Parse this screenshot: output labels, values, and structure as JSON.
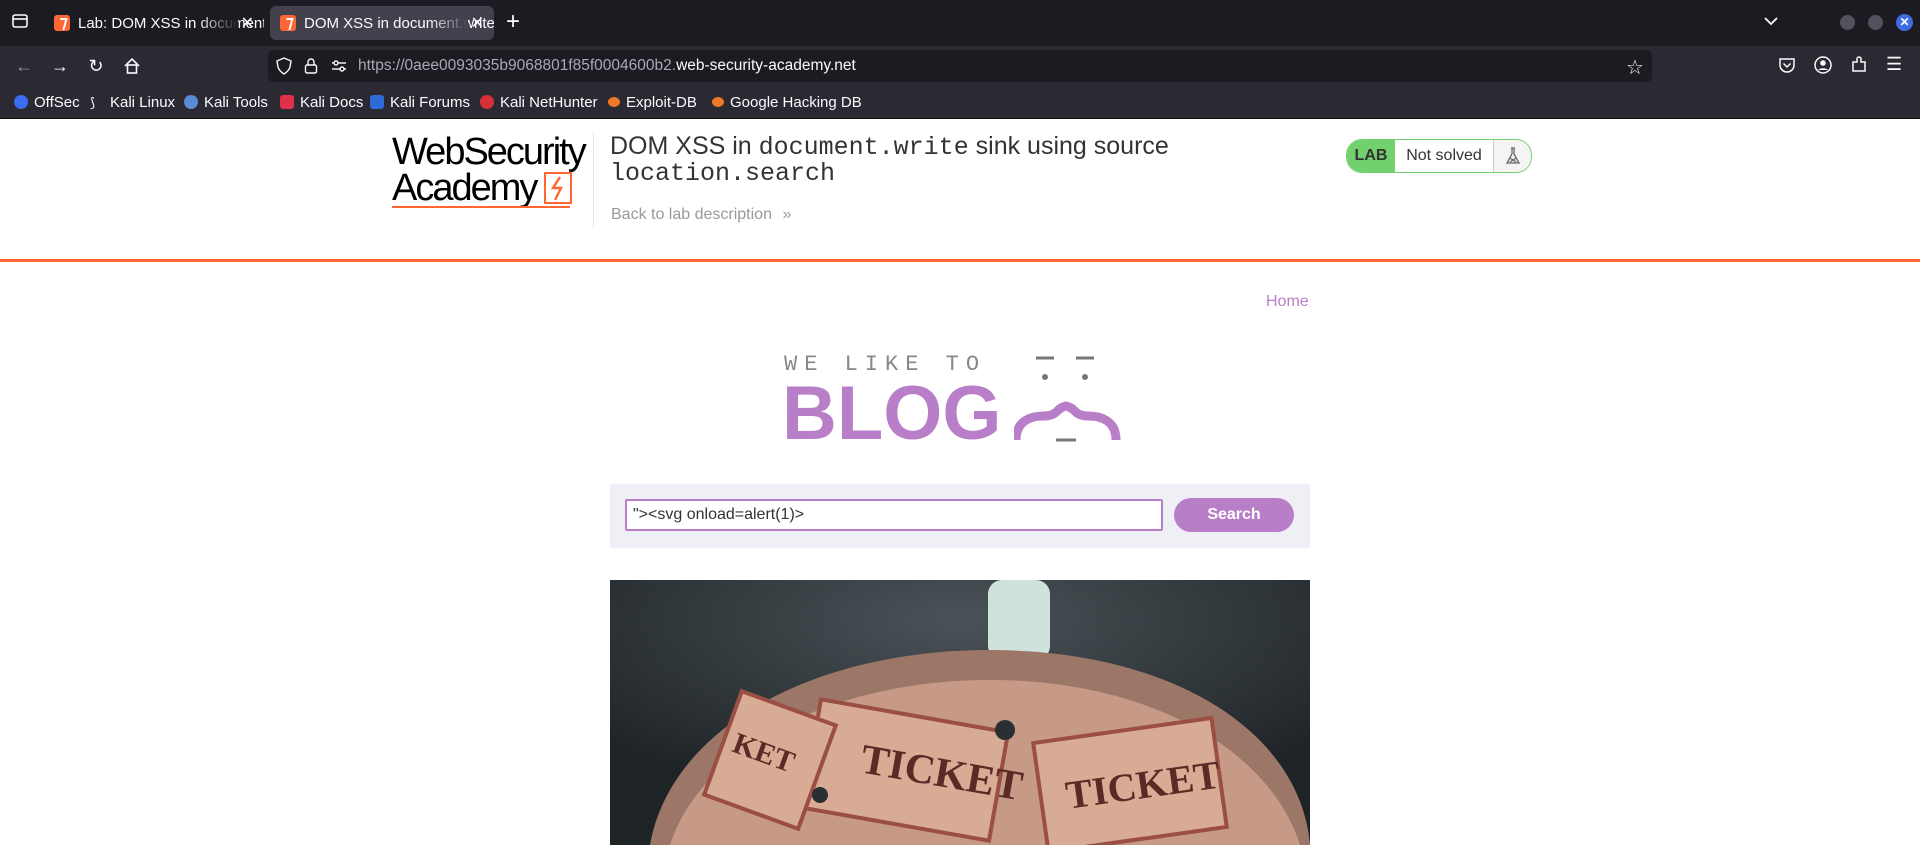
{
  "browser": {
    "tabs": [
      {
        "title": "Lab: DOM XSS in document.write sink using source location.search"
      },
      {
        "title": "DOM XSS in document.write sink using source location.search"
      }
    ],
    "url_prefix": "https://0aee0093035b9068801f85f0004600b2.",
    "url_domain": "web-security-academy.net",
    "bookmarks": [
      {
        "label": "OffSec",
        "color": "#3a6df0"
      },
      {
        "label": "Kali Linux",
        "color": "#ffffff"
      },
      {
        "label": "Kali Tools",
        "color": "#5a8bd6"
      },
      {
        "label": "Kali Docs",
        "color": "#e0304a"
      },
      {
        "label": "Kali Forums",
        "color": "#2f6ad8"
      },
      {
        "label": "Kali NetHunter",
        "color": "#d8303a"
      },
      {
        "label": "Exploit-DB",
        "color": "#f07a2a"
      },
      {
        "label": "Google Hacking DB",
        "color": "#f07a2a"
      }
    ]
  },
  "header": {
    "logo_line1": "WebSecurity",
    "logo_line2": "Academy",
    "lab_title_prefix": "DOM XSS in ",
    "lab_title_code1": "document.write",
    "lab_title_middle": " sink using source",
    "lab_title_code2": "location.search",
    "back_link": "Back to lab description",
    "lab_badge": "LAB",
    "lab_status": "Not solved"
  },
  "page": {
    "nav_home": "Home",
    "blog_tagline": "WE LIKE TO",
    "blog_word": "BLOG",
    "search_value": "\"><svg onload=alert(1)>",
    "search_button": "Search"
  },
  "colors": {
    "accent_orange": "#ff6633",
    "purple": "#b87fc8",
    "lab_green": "#70d16d"
  }
}
